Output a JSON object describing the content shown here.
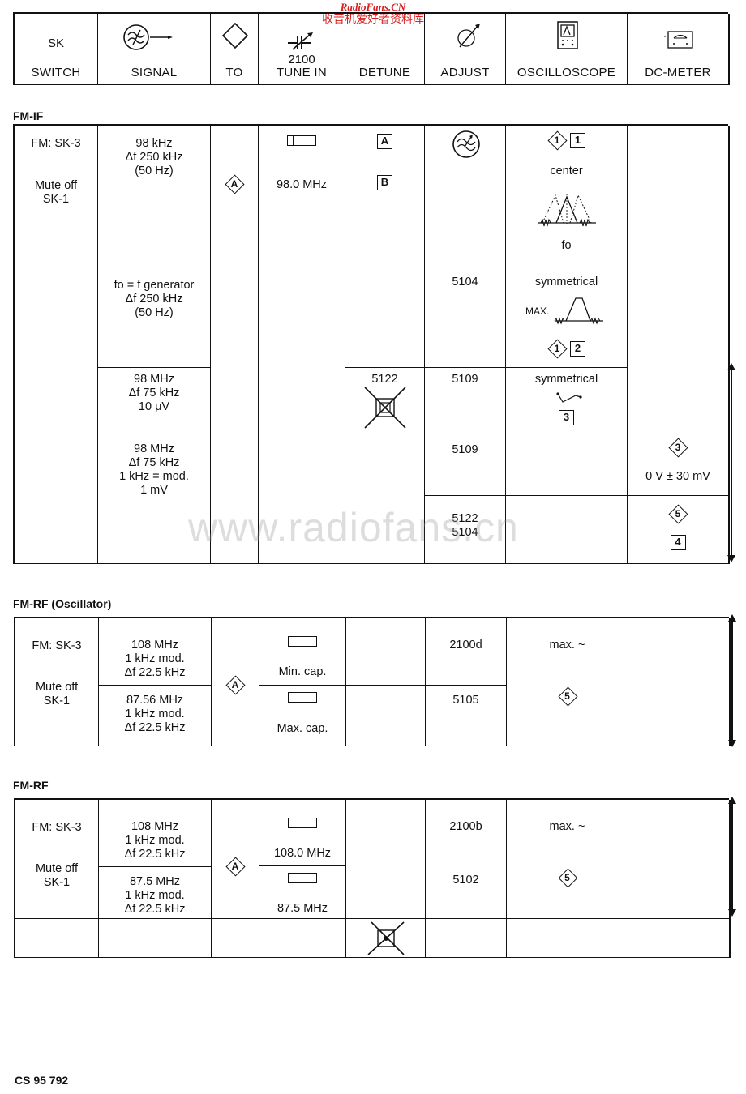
{
  "watermark": {
    "site_en": "RadioFans.CN",
    "site_cn": "收音机爱好者资料库",
    "center": "www.radiofans.cn"
  },
  "header": {
    "columns": [
      {
        "id": "switch",
        "top": "SK",
        "label": "SWITCH",
        "icon": "none"
      },
      {
        "id": "signal",
        "top": "",
        "label": "SIGNAL",
        "icon": "signal-generator-icon"
      },
      {
        "id": "to",
        "top": "",
        "label": "TO",
        "icon": "diamond-icon"
      },
      {
        "id": "tune",
        "top": "2100",
        "label": "TUNE IN",
        "icon": "variable-capacitor-icon"
      },
      {
        "id": "detune",
        "top": "",
        "label": "DETUNE",
        "icon": "none"
      },
      {
        "id": "adjust",
        "top": "",
        "label": "ADJUST",
        "icon": "adjust-trimmer-icon"
      },
      {
        "id": "scope",
        "top": "",
        "label": "OSCILLOSCOPE",
        "icon": "oscilloscope-icon"
      },
      {
        "id": "dcmeter",
        "top": "",
        "label": "DC-METER",
        "icon": "dc-meter-icon"
      }
    ]
  },
  "fm_if": {
    "title": "FM-IF",
    "switch": {
      "line1": "FM: SK-3",
      "line2": "Mute off",
      "line3": "SK-1"
    },
    "to": "A",
    "tune_value": "98.0 MHz",
    "detune_boxes": [
      "A",
      "B"
    ],
    "rows": [
      {
        "signal": [
          "98 kHz",
          "Δf 250 kHz",
          "(50 Hz)"
        ],
        "adjust": "wobbler-icon",
        "scope": {
          "marker_diamond": "1",
          "marker_box": "1",
          "text": "center",
          "curve_label": "fo"
        },
        "dcmeter": ""
      },
      {
        "signal": [
          "fo = f generator",
          "Δf 250 kHz",
          "(50 Hz)"
        ],
        "adjust": "5104",
        "scope": {
          "text": "symmetrical",
          "curve_label": "MAX.",
          "marker_diamond": "1",
          "marker_box": "2"
        },
        "dcmeter": ""
      },
      {
        "signal": [
          "98 MHz",
          "Δf 75 kHz",
          "10 μV"
        ],
        "detune": "5122",
        "adjust": "5109",
        "scope": {
          "text": "symmetrical",
          "marker_box": "3"
        },
        "dcmeter": ""
      },
      {
        "signal": [
          "98 MHz",
          "Δf 75 kHz",
          "1 kHz = mod.",
          "1 mV"
        ],
        "sub": [
          {
            "adjust": "5109",
            "dc_diamond": "3",
            "dc_text": "0 V ± 30 mV"
          },
          {
            "adjust": [
              "5122",
              "5104"
            ],
            "dc_diamond": "5",
            "dc_box": "4"
          }
        ]
      }
    ]
  },
  "fm_rf_osc": {
    "title": "FM-RF (Oscillator)",
    "switch": {
      "line1": "FM: SK-3",
      "line2": "Mute off",
      "line3": "SK-1"
    },
    "to": "A",
    "rows": [
      {
        "signal": [
          "108 MHz",
          "1 kHz mod.",
          "Δf 22.5 kHz"
        ],
        "tune": "Min. cap.",
        "adjust": "2100d"
      },
      {
        "signal": [
          "87.56 MHz",
          "1 kHz mod.",
          "Δf 22.5 kHz"
        ],
        "tune": "Max. cap.",
        "adjust": "5105"
      }
    ],
    "scope_text": "max. ~",
    "scope_diamond": "5"
  },
  "fm_rf": {
    "title": "FM-RF",
    "switch": {
      "line1": "FM: SK-3",
      "line2": "Mute off",
      "line3": "SK-1"
    },
    "to": "A",
    "rows": [
      {
        "signal": [
          "108 MHz",
          "1 kHz mod.",
          "Δf 22.5 kHz"
        ],
        "tune": "108.0 MHz",
        "adjust": "2100b"
      },
      {
        "signal": [
          "87.5 MHz",
          "1 kHz mod.",
          "Δf 22.5 kHz"
        ],
        "tune": "87.5 MHz",
        "adjust": "5102"
      }
    ],
    "scope_text": "max. ~",
    "scope_diamond": "5"
  },
  "footer": {
    "code": "CS 95 792"
  }
}
